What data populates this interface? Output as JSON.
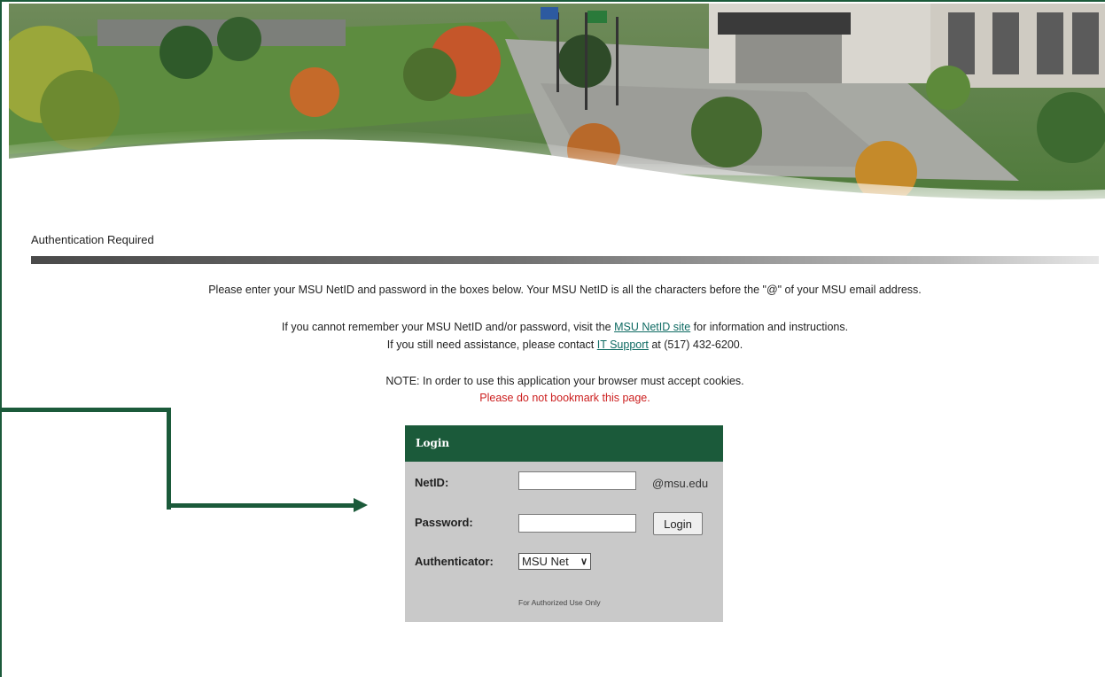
{
  "page": {
    "title": "Authentication Required"
  },
  "messages": {
    "line1": "Please enter your MSU NetID and password in the boxes below. Your MSU NetID is all the characters before the \"@\" of your MSU email address.",
    "line2_pre": "If you cannot remember your MSU NetID and/or password, visit the ",
    "line2_link": "MSU NetID site",
    "line2_post": " for information and instructions.",
    "line3_pre": "If you still need assistance, please contact ",
    "line3_link": "IT Support",
    "line3_post": " at (517) 432-6200.",
    "note": "NOTE: In order to use this application your browser must accept cookies.",
    "warning": "Please do not bookmark this page."
  },
  "login": {
    "header": "Login",
    "netid_label": "NetID:",
    "netid_value": "",
    "netid_suffix": "@msu.edu",
    "password_label": "Password:",
    "password_value": "",
    "login_button": "Login",
    "authenticator_label": "Authenticator:",
    "authenticator_selected": "MSU Net",
    "footer": "For Authorized Use Only"
  },
  "colors": {
    "brand_green": "#1b5a3a",
    "link": "#0f6b63",
    "warning": "#cc1e1e",
    "panel": "#c9c9c9"
  },
  "icons": {
    "arrow": "arrow-right-icon",
    "dropdown": "chevron-down-icon"
  }
}
